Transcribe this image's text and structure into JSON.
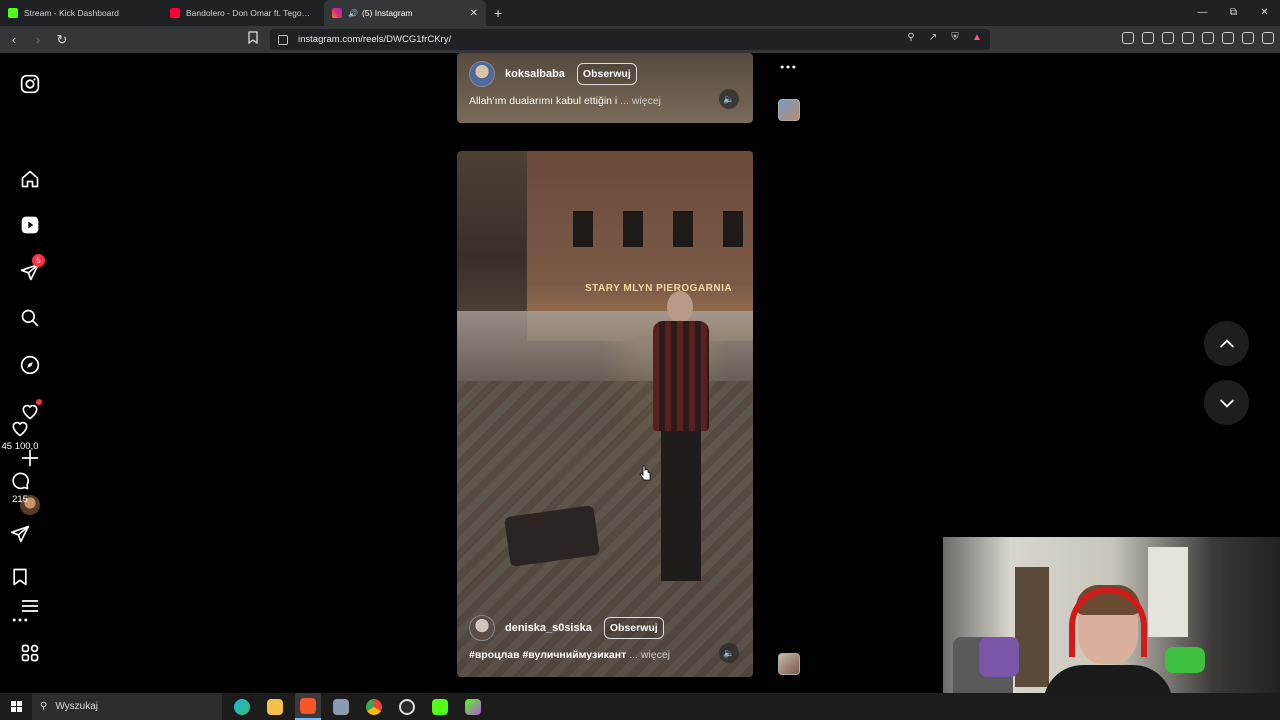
{
  "browser": {
    "tabs": [
      {
        "label": "Stream - Kick Dashboard",
        "favicon_color": "#53fc18",
        "active": false
      },
      {
        "label": "Bandolero - Don Omar ft. Tego Calde",
        "favicon_color": "#ff0033",
        "active": false
      },
      {
        "label": "(5) Instagram",
        "favicon_color": "#e1306c",
        "active": true
      }
    ],
    "url": "instagram.com/reels/DWCG1frCKry/"
  },
  "sidebar": {
    "notification_count": "5"
  },
  "reels": [
    {
      "username": "koksalbaba",
      "follow_label": "Obserwuj",
      "caption": "Allah’ım dualarımı kabul ettiğin i",
      "more_label": "... więcej"
    },
    {
      "username": "deniska_s0siskа",
      "follow_label": "Obserwuj",
      "caption": "#вроцлав #вуличниймузикант",
      "more_label": "... więcej",
      "sign_text": "STARY MLYN PIEROGARNIA",
      "likes": "45 100,0",
      "comments": "215"
    }
  ],
  "taskbar": {
    "search_label": "Wyszukaj"
  },
  "colors": {
    "badge": "#ff3040",
    "background": "#000000"
  }
}
